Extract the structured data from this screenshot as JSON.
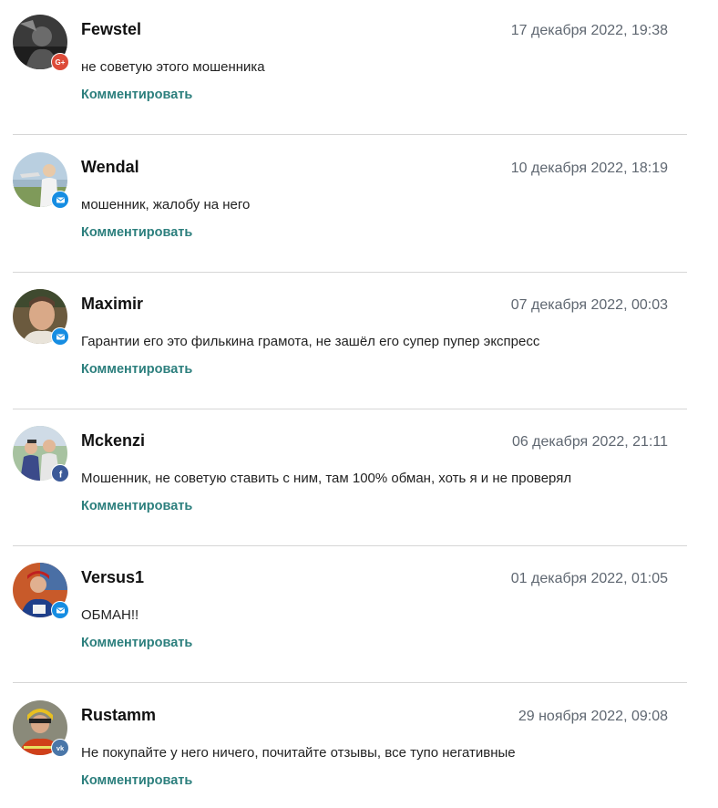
{
  "comments": [
    {
      "username": "Fewstel",
      "date": "17 декабря 2022, 19:38",
      "text": "не советую этого мошенника",
      "reply_label": "Комментировать",
      "source": "google-plus-icon",
      "source_color": "#dd4b39"
    },
    {
      "username": "Wendal",
      "date": "10 декабря 2022, 18:19",
      "text": "мошенник, жалобу на него",
      "reply_label": "Комментировать",
      "source": "mail-icon",
      "source_color": "#168de2"
    },
    {
      "username": "Maximir",
      "date": "07 декабря 2022, 00:03",
      "text": "Гарантии его это филькина грамота, не зашёл его супер пупер экспресс",
      "reply_label": "Комментировать",
      "source": "mail-icon",
      "source_color": "#168de2"
    },
    {
      "username": "Mckenzi",
      "date": "06 декабря 2022, 21:11",
      "text": "Мошенник, не советую ставить с ним, там 100% обман, хоть я и не проверял",
      "reply_label": "Комментировать",
      "source": "facebook-icon",
      "source_color": "#3b5998"
    },
    {
      "username": "Versus1",
      "date": "01 декабря 2022, 01:05",
      "text": "ОБМАН!!",
      "reply_label": "Комментировать",
      "source": "mail-icon",
      "source_color": "#168de2"
    },
    {
      "username": "Rustamm",
      "date": "29 ноября 2022, 09:08",
      "text": "Не покупайте у него ничего, почитайте отзывы, все тупо негативные",
      "reply_label": "Комментировать",
      "source": "vk-icon",
      "source_color": "#4a76a8"
    }
  ]
}
